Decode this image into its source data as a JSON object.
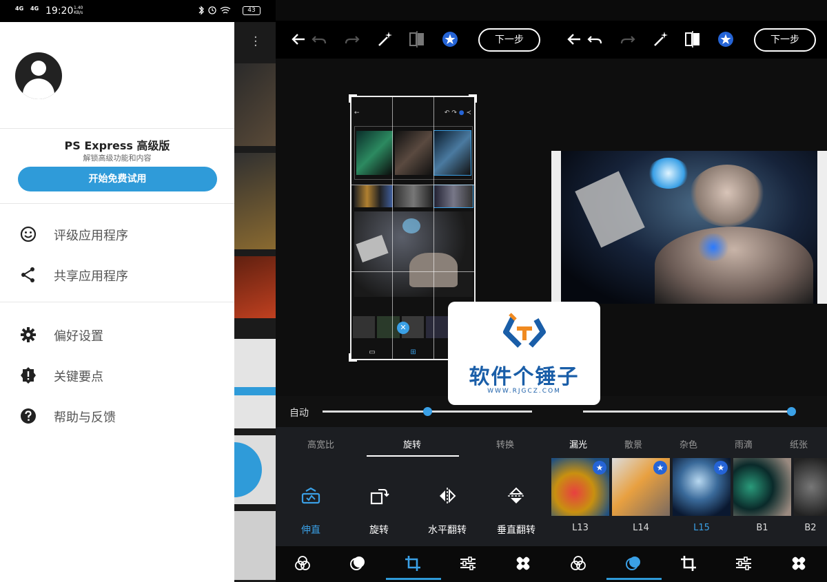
{
  "status_bar": {
    "signal_1": "4G",
    "signal_2": "4G",
    "time": "19:20",
    "speed_value": "1.40",
    "speed_unit": "KB/s",
    "battery": "43"
  },
  "drawer": {
    "premium_title": "PS Express 高级版",
    "premium_subtitle": "解锁高级功能和内容",
    "trial_button": "开始免费试用",
    "menu": [
      {
        "icon": "smiley-icon",
        "label": "评级应用程序"
      },
      {
        "icon": "share-icon",
        "label": "共享应用程序"
      },
      {
        "icon": "gear-icon",
        "label": "偏好设置"
      },
      {
        "icon": "alert-badge-icon",
        "label": "关键要点"
      },
      {
        "icon": "help-icon",
        "label": "帮助与反馈"
      }
    ]
  },
  "editor_left": {
    "next_button": "下一步",
    "slider_label": "自动",
    "slider_value": 0.5,
    "tabs": [
      "高宽比",
      "旋转",
      "转换"
    ],
    "active_tab": "旋转",
    "tools": [
      {
        "icon": "straighten-icon",
        "label": "伸直"
      },
      {
        "icon": "rotate-icon",
        "label": "旋转"
      },
      {
        "icon": "flip-horizontal-icon",
        "label": "水平翻转"
      },
      {
        "icon": "flip-vertical-icon",
        "label": "垂直翻转"
      }
    ],
    "active_tool": "伸直"
  },
  "editor_right": {
    "next_button": "下一步",
    "slider_value": 1.0,
    "tabs": [
      "漏光",
      "散景",
      "杂色",
      "雨滴",
      "纸张"
    ],
    "active_tab": "漏光",
    "filters": [
      {
        "label": "L13",
        "premium": true
      },
      {
        "label": "L14",
        "premium": true
      },
      {
        "label": "L15",
        "premium": true
      },
      {
        "label": "B1",
        "premium": false
      },
      {
        "label": "B2",
        "premium": false
      }
    ],
    "active_filter": "L15"
  },
  "watermark": {
    "title": "软件个锤子",
    "url": "WWW.RJGCZ.COM"
  },
  "colors": {
    "accent": "#2f9bd9",
    "premium_star": "#2564d6",
    "editor_bg": "#0b0b0b",
    "tools_bg": "#1c1e22"
  }
}
